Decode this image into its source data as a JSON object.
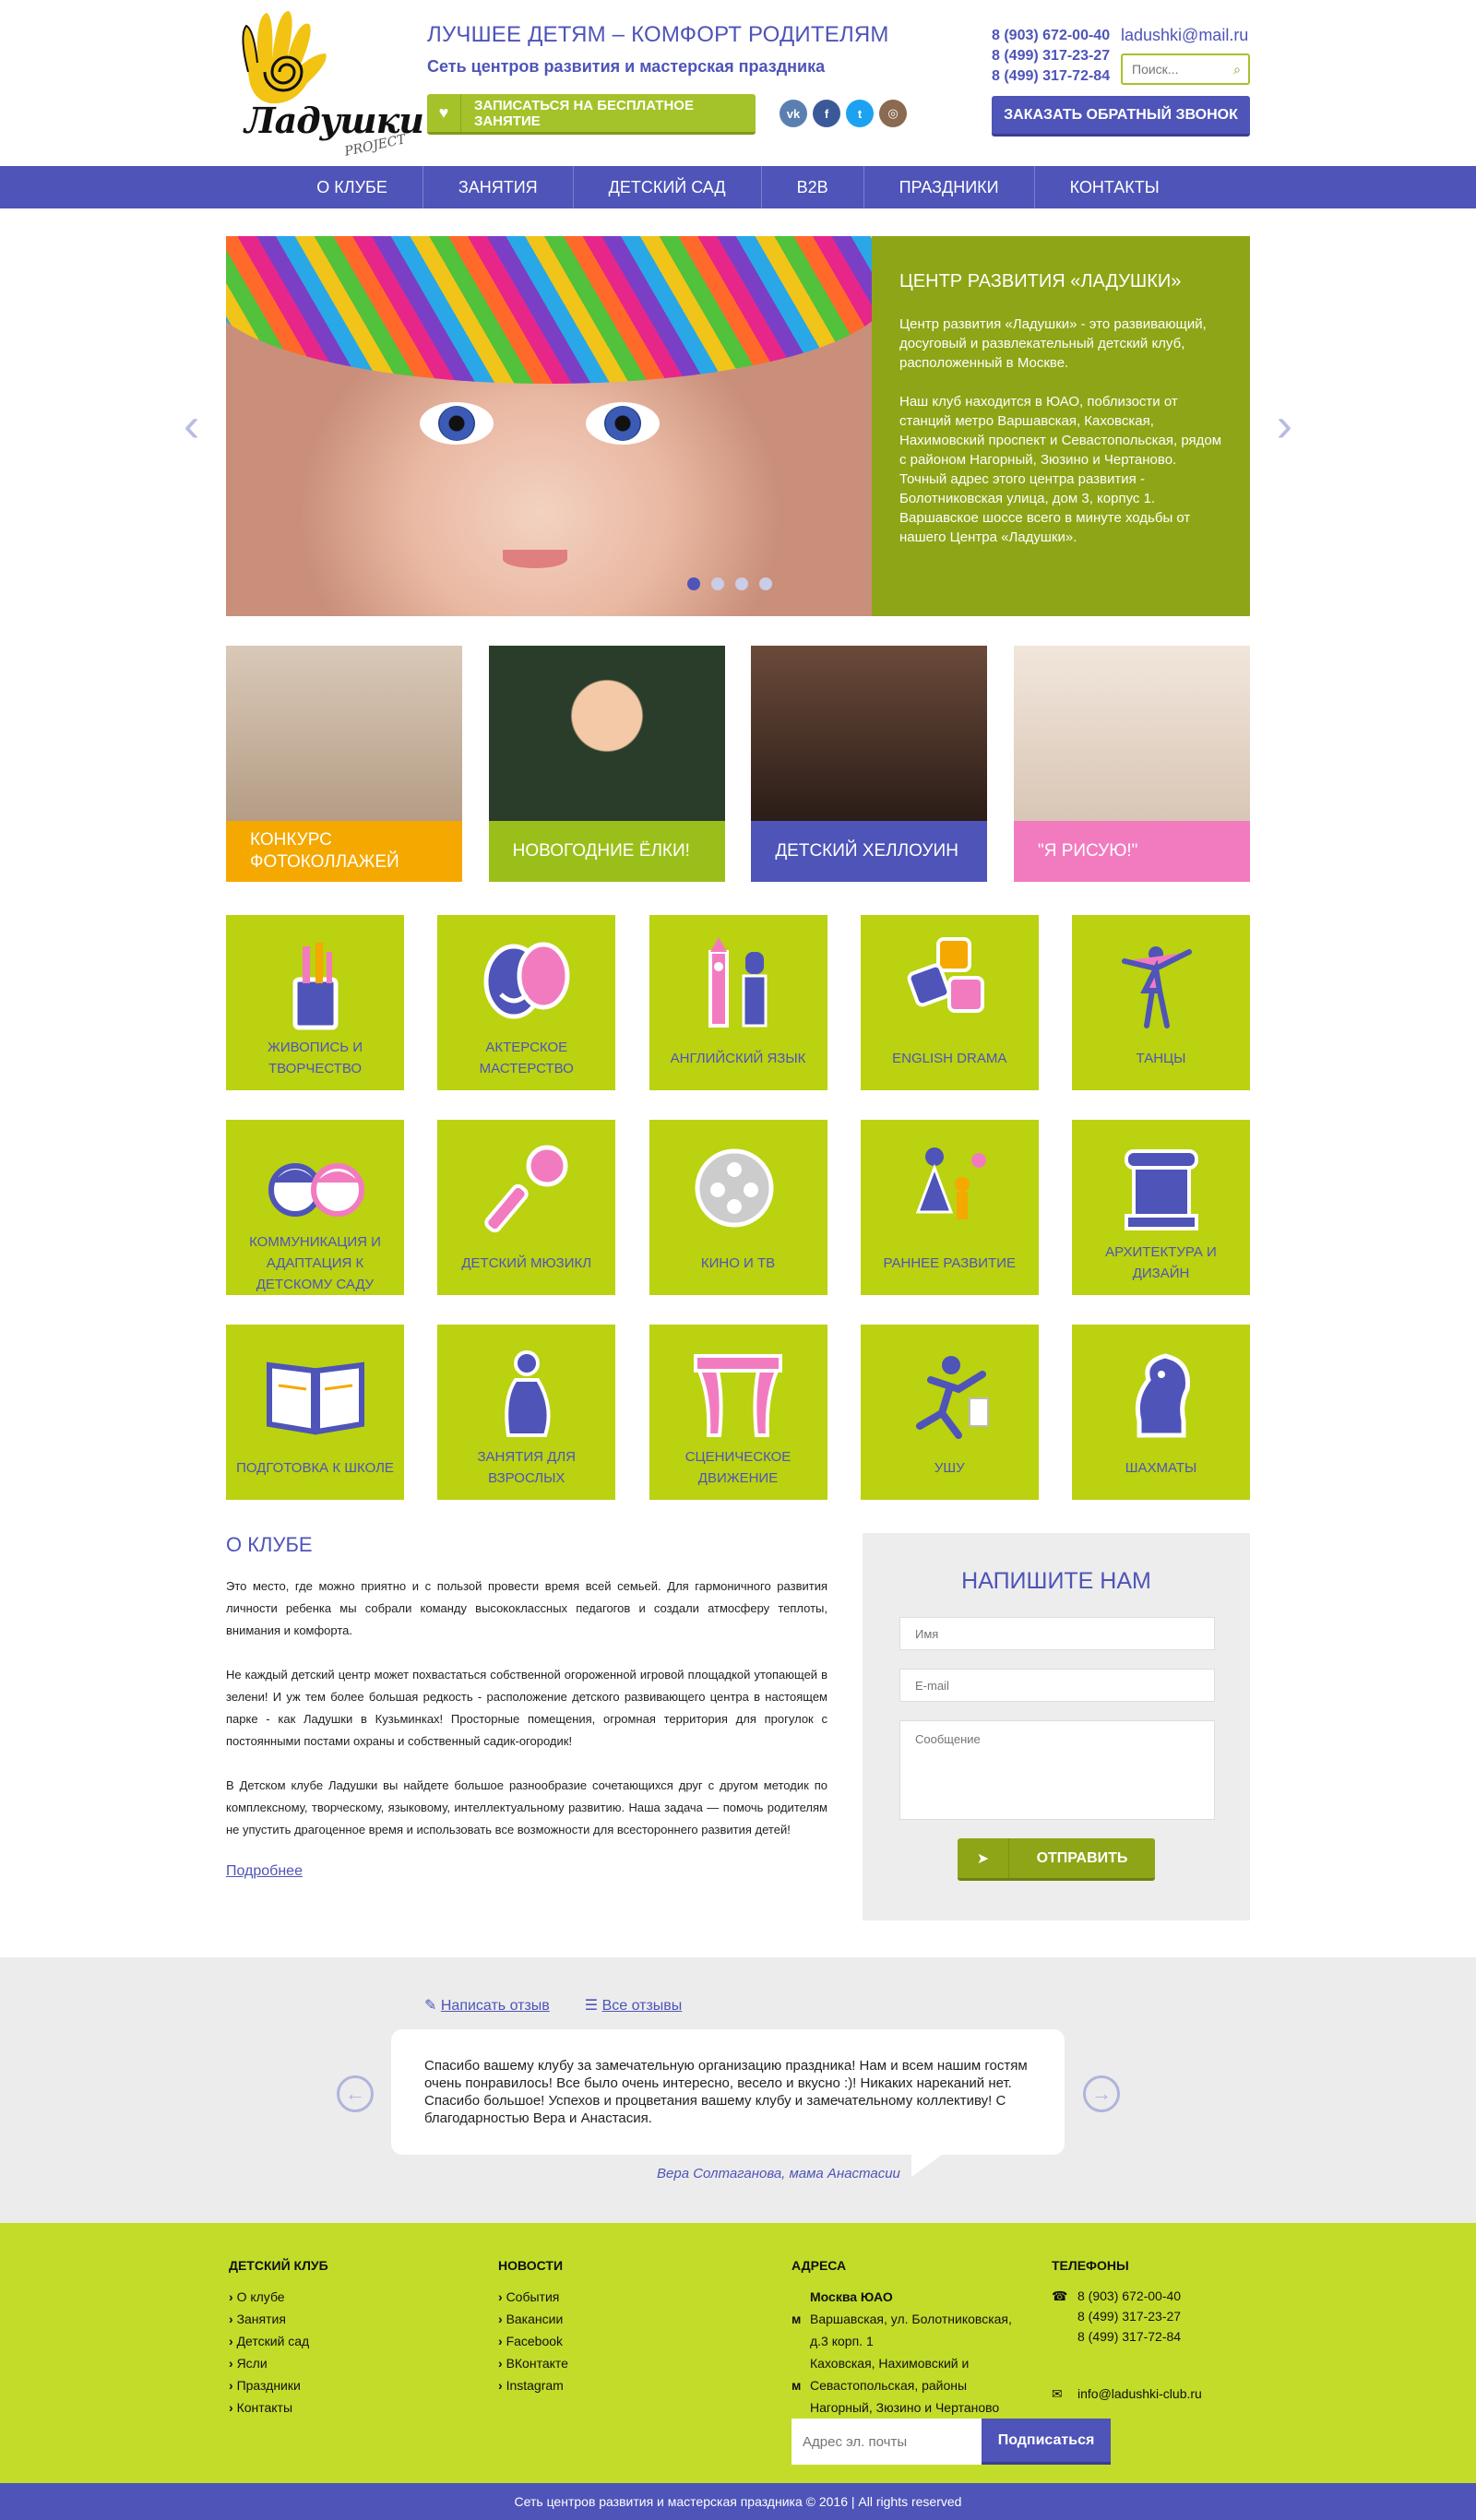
{
  "header": {
    "brand": "Ладушки",
    "brand_sub": "PROJECT",
    "slogan": "ЛУЧШЕЕ ДЕТЯМ – КОМФОРТ РОДИТЕЛЯМ",
    "subslogan": "Сеть центров развития и мастерская праздника",
    "free_btn": "ЗАПИСАТЬСЯ НА БЕСПЛАТНОЕ ЗАНЯТИЕ",
    "phones": [
      "8 (903) 672-00-40",
      "8 (499) 317-23-27",
      "8 (499) 317-72-84"
    ],
    "email": "ladushki@mail.ru",
    "search_placeholder": "Поиск...",
    "callback_btn": "ЗАКАЗАТЬ ОБРАТНЫЙ ЗВОНОК",
    "socials": [
      {
        "icon": "vk-icon",
        "glyph": "vk",
        "color": "#5b7fb0"
      },
      {
        "icon": "facebook-icon",
        "glyph": "f",
        "color": "#3b5998"
      },
      {
        "icon": "twitter-icon",
        "glyph": "t",
        "color": "#1da1f2"
      },
      {
        "icon": "instagram-icon",
        "glyph": "◎",
        "color": "#8a6a50"
      }
    ]
  },
  "nav": [
    "О КЛУБЕ",
    "ЗАНЯТИЯ",
    "ДЕТСКИЙ САД",
    "B2B",
    "ПРАЗДНИКИ",
    "КОНТАКТЫ"
  ],
  "slider": {
    "title": "ЦЕНТР РАЗВИТИЯ «ЛАДУШКИ»",
    "p1": "Центр развития «Ладушки» - это развивающий, досуговый и развлекательный детский клуб, расположенный в Москве.",
    "p2": "Наш клуб находится в ЮАО, поблизости от станций метро Варшавская, Каховская, Нахимовский проспект и Севастопольская, рядом с районом Нагорный, Зюзино и Чертаново. Точный адрес этого центра развития - Болотниковская улица, дом 3, корпус 1. Варшавское шоссе всего в минуте ходьбы от нашего Центра «Ладушки».",
    "slides": 4,
    "active": 1
  },
  "promos": [
    {
      "label": "КОНКУРС ФОТОКОЛЛАЖЕЙ",
      "color": "#f5a800"
    },
    {
      "label": "НОВОГОДНИЕ ЁЛКИ!",
      "color": "#9bbf1a"
    },
    {
      "label": "ДЕТСКИЙ ХЕЛЛОУИН",
      "color": "#4e54b8"
    },
    {
      "label": "\"Я РИСУЮ!\"",
      "color": "#f27bc0"
    }
  ],
  "categories": [
    {
      "label": "ЖИВОПИСЬ И ТВОРЧЕСТВО",
      "icon": "paint-brushes-icon"
    },
    {
      "label": "АКТЕРСКОЕ МАСТЕРСТВО",
      "icon": "theater-masks-icon"
    },
    {
      "label": "АНГЛИЙСКИЙ ЯЗЫК",
      "icon": "big-ben-guard-icon"
    },
    {
      "label": "ENGLISH DRAMA",
      "icon": "abc-blocks-icon"
    },
    {
      "label": "ТАНЦЫ",
      "icon": "ballerina-icon"
    },
    {
      "label": "КОММУНИКАЦИЯ И АДАПТАЦИЯ К ДЕТСКОМУ САДУ",
      "icon": "kids-faces-icon"
    },
    {
      "label": "ДЕТСКИЙ МЮЗИКЛ",
      "icon": "microphone-icon"
    },
    {
      "label": "КИНО И ТВ",
      "icon": "film-reel-icon"
    },
    {
      "label": "РАННЕЕ РАЗВИТИЕ",
      "icon": "mother-child-icon"
    },
    {
      "label": "АРХИТЕКТУРА И ДИЗАЙН",
      "icon": "column-icon"
    },
    {
      "label": "ПОДГОТОВКА К ШКОЛЕ",
      "icon": "open-book-icon"
    },
    {
      "label": "ЗАНЯТИЯ ДЛЯ ВЗРОСЛЫХ",
      "icon": "pregnant-woman-icon"
    },
    {
      "label": "СЦЕНИЧЕСКОЕ ДВИЖЕНИЕ",
      "icon": "stage-curtain-icon"
    },
    {
      "label": "УШУ",
      "icon": "martial-arts-icon"
    },
    {
      "label": "ШАХМАТЫ",
      "icon": "chess-knight-icon"
    }
  ],
  "about": {
    "title": "О КЛУБЕ",
    "p1": "Это место, где можно приятно и с пользой провести время всей семьей. Для гармоничного развития личности ребенка мы собрали команду высококлассных педагогов и создали атмосферу теплоты, внимания и комфорта.",
    "p2": "Не каждый детский центр может похвастаться собственной огороженной игровой площадкой утопающей в зелени! И уж тем более большая редкость - расположение детского развивающего центра в настоящем парке - как Ладушки в Кузьминках! Просторные помещения, огромная территория для прогулок с постоянными постами охраны и собственный садик-огородик!",
    "p3": "В Детском клубе Ладушки вы найдете большое разнообразие сочетающихся друг с другом методик по комплексному, творческому, языковому, интеллектуальному развитию. Наша задача — помочь родителям не упустить драгоценное время и использовать все возможности для всестороннего развития детей!",
    "more": "Подробнее"
  },
  "contact_form": {
    "title": "НАПИШИТЕ НАМ",
    "name_placeholder": "Имя",
    "email_placeholder": "E-mail",
    "message_placeholder": "Сообщение",
    "submit": "ОТПРАВИТЬ"
  },
  "reviews": {
    "write": "Написать отзыв",
    "all": "Все отзывы",
    "text": "Спасибо вашему клубу за замечательную организацию праздника! Нам и всем нашим гостям очень понравилось! Все было очень интересно, весело и вкусно :)! Никаких нареканий нет. Спасибо большое! Успехов и процветания вашему клубу и замечательному коллективу! С благодарностью Вера и Анастасия.",
    "author": "Вера Солтаганова, мама Анастасии"
  },
  "footer": {
    "col1_title": "ДЕТСКИЙ КЛУБ",
    "col1": [
      "О клубе",
      "Занятия",
      "Детский сад",
      "Ясли",
      "Праздники",
      "Контакты"
    ],
    "col2_title": "НОВОСТИ",
    "col2": [
      "События",
      "Вакансии",
      "Facebook",
      "ВКонтакте",
      "Instagram"
    ],
    "col3_title": "АДРЕСА",
    "city": "Москва ЮАО",
    "address1": "Варшавская, ул. Болотниковская, д.3 корп. 1",
    "address2": "Каховская, Нахимовский и Севастопольская, районы Нагорный, Зюзино и Чертаново",
    "col4_title": "ТЕЛЕФОНЫ",
    "phones": [
      "8 (903) 672-00-40",
      "8 (499) 317-23-27",
      "8 (499) 317-72-84"
    ],
    "email": "info@ladushki-club.ru",
    "subscribe_placeholder": "Адрес эл. почты",
    "subscribe_btn": "Подписаться",
    "copyright": "Сеть центров развития и мастерская праздника © 2016 | All rights reserved"
  }
}
